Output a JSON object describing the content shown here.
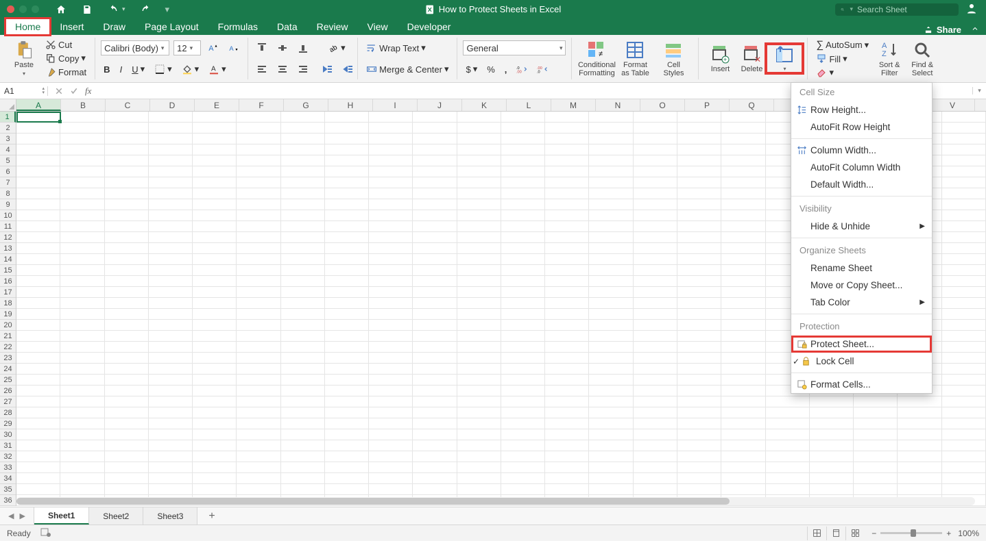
{
  "title": "How to Protect Sheets in Excel",
  "search_placeholder": "Search Sheet",
  "share_label": "Share",
  "tabs": [
    "Home",
    "Insert",
    "Draw",
    "Page Layout",
    "Formulas",
    "Data",
    "Review",
    "View",
    "Developer"
  ],
  "clipboard": {
    "paste": "Paste",
    "cut": "Cut",
    "copy": "Copy",
    "format": "Format"
  },
  "font": {
    "name": "Calibri (Body)",
    "size": "12"
  },
  "alignment": {
    "wrap": "Wrap Text",
    "merge": "Merge & Center"
  },
  "number": {
    "format": "General"
  },
  "styles": {
    "cond": "Conditional\nFormatting",
    "table": "Format\nas Table",
    "cell": "Cell\nStyles"
  },
  "cells_group": {
    "insert": "Insert",
    "delete": "Delete"
  },
  "editing": {
    "autosum": "AutoSum",
    "fill": "Fill",
    "sort": "Sort &\nFilter",
    "find": "Find &\nSelect"
  },
  "menu": {
    "cell_size": "Cell Size",
    "row_height": "Row Height...",
    "autofit_row": "AutoFit Row Height",
    "col_width": "Column Width...",
    "autofit_col": "AutoFit Column Width",
    "default_width": "Default Width...",
    "visibility": "Visibility",
    "hide": "Hide & Unhide",
    "organize": "Organize Sheets",
    "rename": "Rename Sheet",
    "move": "Move or Copy Sheet...",
    "tab_color": "Tab Color",
    "protection": "Protection",
    "protect": "Protect Sheet...",
    "lock": "Lock Cell",
    "format_cells": "Format Cells..."
  },
  "name_box": "A1",
  "columns": [
    "A",
    "B",
    "C",
    "D",
    "E",
    "F",
    "G",
    "H",
    "I",
    "J",
    "K",
    "L",
    "M",
    "N",
    "O",
    "P",
    "Q",
    "V"
  ],
  "rows": [
    1,
    2,
    3,
    4,
    5,
    6,
    7,
    8,
    9,
    10,
    11,
    12,
    13,
    14,
    15,
    16,
    17,
    18,
    19,
    20,
    21,
    22,
    23,
    24,
    25,
    26,
    27,
    28,
    29,
    30,
    31,
    32,
    33,
    34,
    35,
    36
  ],
  "sheets": [
    "Sheet1",
    "Sheet2",
    "Sheet3"
  ],
  "status": {
    "ready": "Ready",
    "zoom": "100%"
  }
}
